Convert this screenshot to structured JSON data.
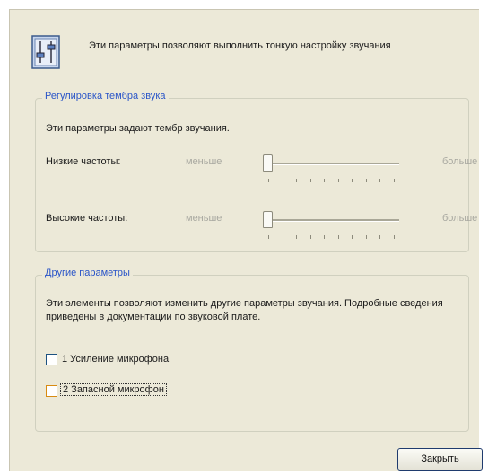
{
  "header": {
    "icon": "sound-settings-icon",
    "text": "Эти параметры позволяют выполнить тонкую настройку звучания"
  },
  "tone_group": {
    "title": "Регулировка тембра звука",
    "description": "Эти параметры задают тембр звучания.",
    "bass": {
      "label": "Низкие частоты:",
      "min_label": "меньше",
      "max_label": "больше",
      "level": 0
    },
    "treble": {
      "label": "Высокие частоты:",
      "min_label": "меньше",
      "max_label": "больше",
      "level": 0
    }
  },
  "other_group": {
    "title": "Другие параметры",
    "description": "Эти элементы позволяют изменить другие параметры звучания. Подробные сведения приведены в документации по звуковой плате.",
    "options": [
      {
        "label": "1  Усиление микрофона",
        "checked": false
      },
      {
        "label": "2  Запасной микрофон",
        "checked": false
      }
    ]
  },
  "footer": {
    "close_label": "Закрыть"
  },
  "colors": {
    "group_title": "#2a55c8",
    "dialog_bg": "#ece9d8"
  }
}
